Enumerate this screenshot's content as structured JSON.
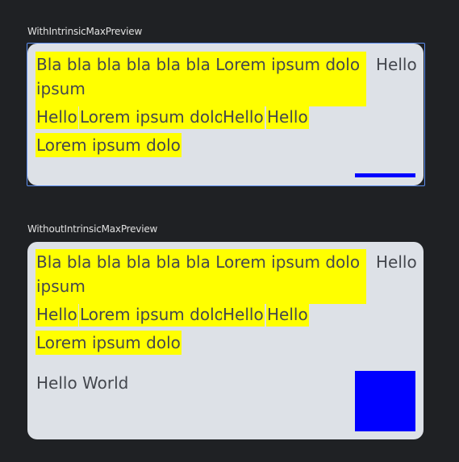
{
  "previews": [
    {
      "name": "WithIntrinsicMaxPreview",
      "paragraph": "Bla bla bla bla bla bla Lorem ipsum dolo ipsum",
      "side_text": "Hello",
      "chips": [
        "Hello",
        "Lorem ipsum dolo",
        "Hello",
        "Hello",
        "Lorem ipsum dolo"
      ],
      "selected": true
    },
    {
      "name": "WithoutIntrinsicMaxPreview",
      "paragraph": "Bla bla bla bla bla bla Lorem ipsum dolo ipsum",
      "side_text": "Hello",
      "chips": [
        "Hello",
        "Lorem ipsum dolo",
        "Hello",
        "Hello",
        "Lorem ipsum dolo"
      ],
      "footer_text": "Hello World",
      "selected": false
    }
  ],
  "colors": {
    "background": "#1f2124",
    "card": "#dde1e7",
    "chip": "#ffff00",
    "text": "#44474e",
    "accent_blue": "#0000ff",
    "selection": "#5b8def"
  }
}
